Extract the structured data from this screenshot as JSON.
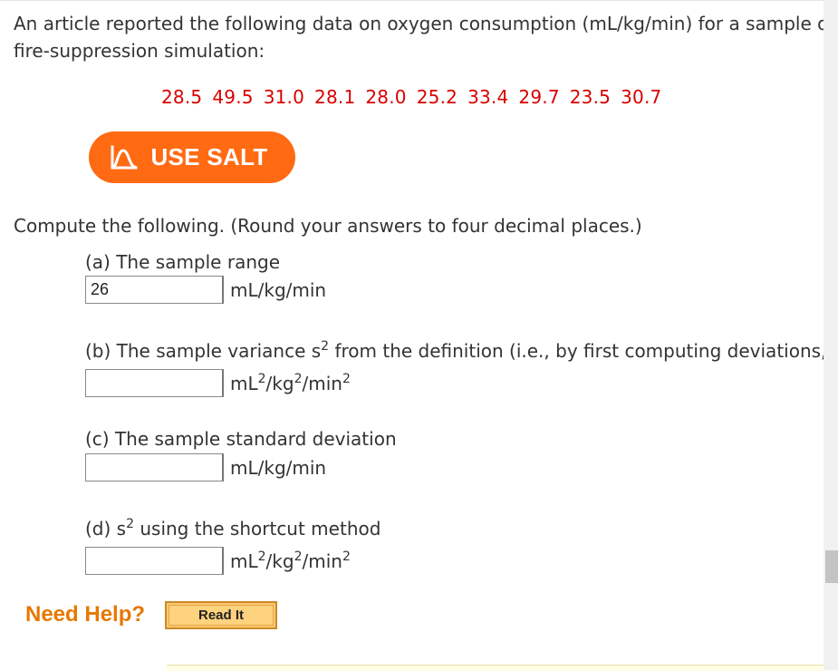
{
  "problem": {
    "intro_line1": "An article reported the following data on oxygen consumption (mL/kg/min) for a sample of",
    "intro_line2": "fire-suppression simulation:",
    "data_values": [
      "28.5",
      "49.5",
      "31.0",
      "28.1",
      "28.0",
      "25.2",
      "33.4",
      "29.7",
      "23.5",
      "30.7"
    ]
  },
  "salt_button": {
    "label": "USE SALT",
    "icon": "salt-curve-icon",
    "color": "#ff6a13"
  },
  "instructions": "Compute the following. (Round your answers to four decimal places.)",
  "parts": {
    "a": {
      "label": "(a) The sample range",
      "value": "26",
      "unit": "mL/kg/min"
    },
    "b": {
      "label_before": "(b) The sample variance s",
      "label_sup": "2",
      "label_after": " from the definition (i.e., by first computing deviations, t",
      "value": "",
      "unit_parts": [
        "mL",
        "2",
        "/kg",
        "2",
        "/min",
        "2"
      ]
    },
    "c": {
      "label": "(c) The sample standard deviation",
      "value": "",
      "unit": "mL/kg/min"
    },
    "d": {
      "label_before": "(d) s",
      "label_sup": "2",
      "label_after": " using the shortcut method",
      "value": "",
      "unit_parts": [
        "mL",
        "2",
        "/kg",
        "2",
        "/min",
        "2"
      ]
    }
  },
  "help": {
    "title": "Need Help?",
    "read_it_label": "Read It",
    "title_color": "#e87800"
  },
  "colors": {
    "data_red": "#d90000",
    "read_it_bg": "#ffd27e"
  }
}
